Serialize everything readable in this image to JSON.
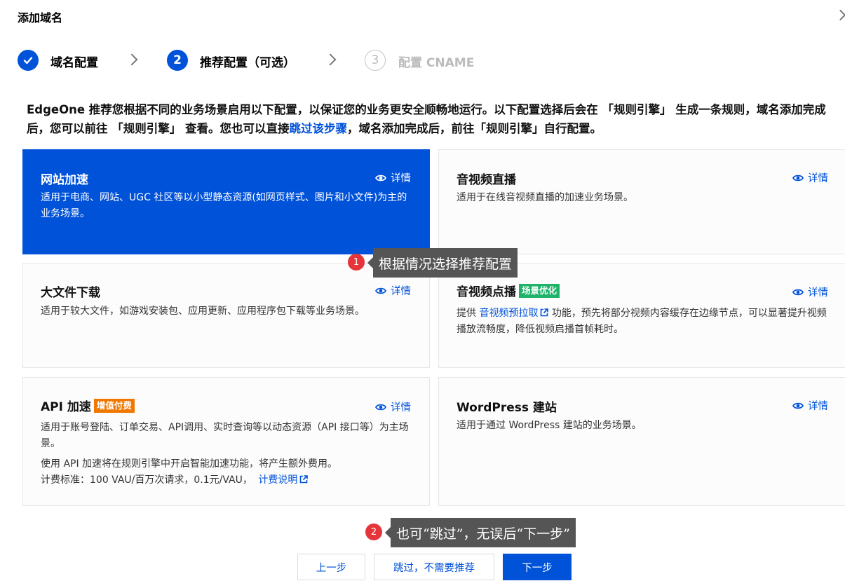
{
  "dialog": {
    "title": "添加域名"
  },
  "steps": [
    {
      "label": "域名配置",
      "number": "",
      "state": "done"
    },
    {
      "label": "推荐配置（可选）",
      "number": "2",
      "state": "active"
    },
    {
      "label": "配置 CNAME",
      "number": "3",
      "state": "todo"
    }
  ],
  "intro": {
    "part1": "EdgeOne 推荐您根据不同的业务场景启用以下配置，以保证您的业务更安全顺畅地运行。以下配置选择后会在 「规则引擎」 生成一条规则，域名添加完成后，您可以前往 「规则引擎」 查看。您也可以直接",
    "link": "跳过该步骤",
    "part2": "，域名添加完成后，前往「规则引擎」自行配置。"
  },
  "detail_label": "详情",
  "cards": {
    "website": {
      "title": "网站加速",
      "desc": "适用于电商、网站、UGC 社区等以小型静态资源(如网页样式、图片和小文件)为主的业务场景。"
    },
    "live": {
      "title": "音视频直播",
      "desc": "适用于在线音视频直播的加速业务场景。"
    },
    "download": {
      "title": "大文件下载",
      "desc": "适用于较大文件，如游戏安装包、应用更新、应用程序包下载等业务场景。"
    },
    "vod": {
      "title": "音视频点播",
      "badge": "场景优化",
      "desc_prefix": "提供 ",
      "desc_link": "音视频预拉取",
      "desc_suffix": " 功能，预先将部分视频内容缓存在边缘节点，可以显著提升视频播放流畅度，降低视频启播首帧耗时。"
    },
    "api": {
      "title": "API 加速",
      "badge": "增值付费",
      "desc1": "适用于账号登陆、订单交易、API调用、实时查询等以动态资源（API 接口等）为主场景。",
      "desc2": "使用 API 加速将在规则引擎中开启智能加速功能，将产生额外费用。",
      "desc3": "计费标准：100 VAU/百万次请求，0.1元/VAU，",
      "desc3_link": "计费说明"
    },
    "wordpress": {
      "title": "WordPress 建站",
      "desc": "适用于通过 WordPress 建站的业务场景。"
    }
  },
  "tooltips": [
    {
      "number": "1",
      "text": "根据情况选择推荐配置"
    },
    {
      "number": "2",
      "text": "也可“跳过”，无误后“下一步”"
    }
  ],
  "footer": {
    "prev": "上一步",
    "skip": "跳过，不需要推荐",
    "next": "下一步"
  },
  "colors": {
    "primary": "#0052d9",
    "badge_green": "#1fb36a",
    "badge_orange": "#f07800",
    "tip_red": "#e5343a"
  }
}
